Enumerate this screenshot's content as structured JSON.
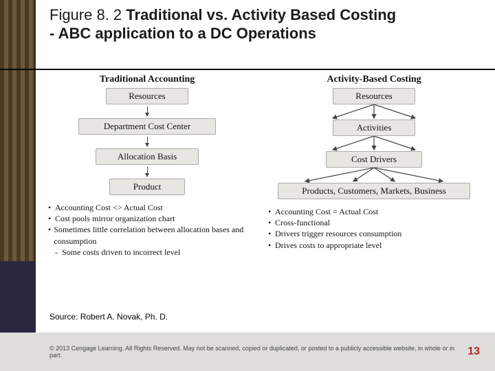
{
  "title": {
    "figlabel": "Figure 8. 2 ",
    "line1": "Traditional vs. Activity Based Costing",
    "line2": "- ABC application to a DC Operations"
  },
  "diagram": {
    "left": {
      "heading": "Traditional Accounting",
      "boxes": [
        "Resources",
        "Department Cost Center",
        "Allocation Basis",
        "Product"
      ],
      "bullets": [
        "Accounting Cost <> Actual Cost",
        "Cost pools mirror organization chart",
        "Sometimes little correlation between allocation bases and consumption",
        "Some costs driven to incorrect level"
      ]
    },
    "right": {
      "heading": "Activity-Based Costing",
      "boxes": [
        "Resources",
        "Activities",
        "Cost Drivers",
        "Products, Customers, Markets, Business"
      ],
      "bullets": [
        "Accounting Cost = Actual Cost",
        "Cross-functional",
        "Drivers trigger resources consumption",
        "Drives costs to appropriate level"
      ]
    }
  },
  "source": "Source: Robert A. Novak, Ph. D.",
  "footer": {
    "copyright": "© 2013 Cengage Learning. All Rights Reserved. May not be scanned, copied or duplicated, or posted to a publicly accessible website, in whole or in part.",
    "page": "13"
  },
  "bullet_glyph": "•"
}
